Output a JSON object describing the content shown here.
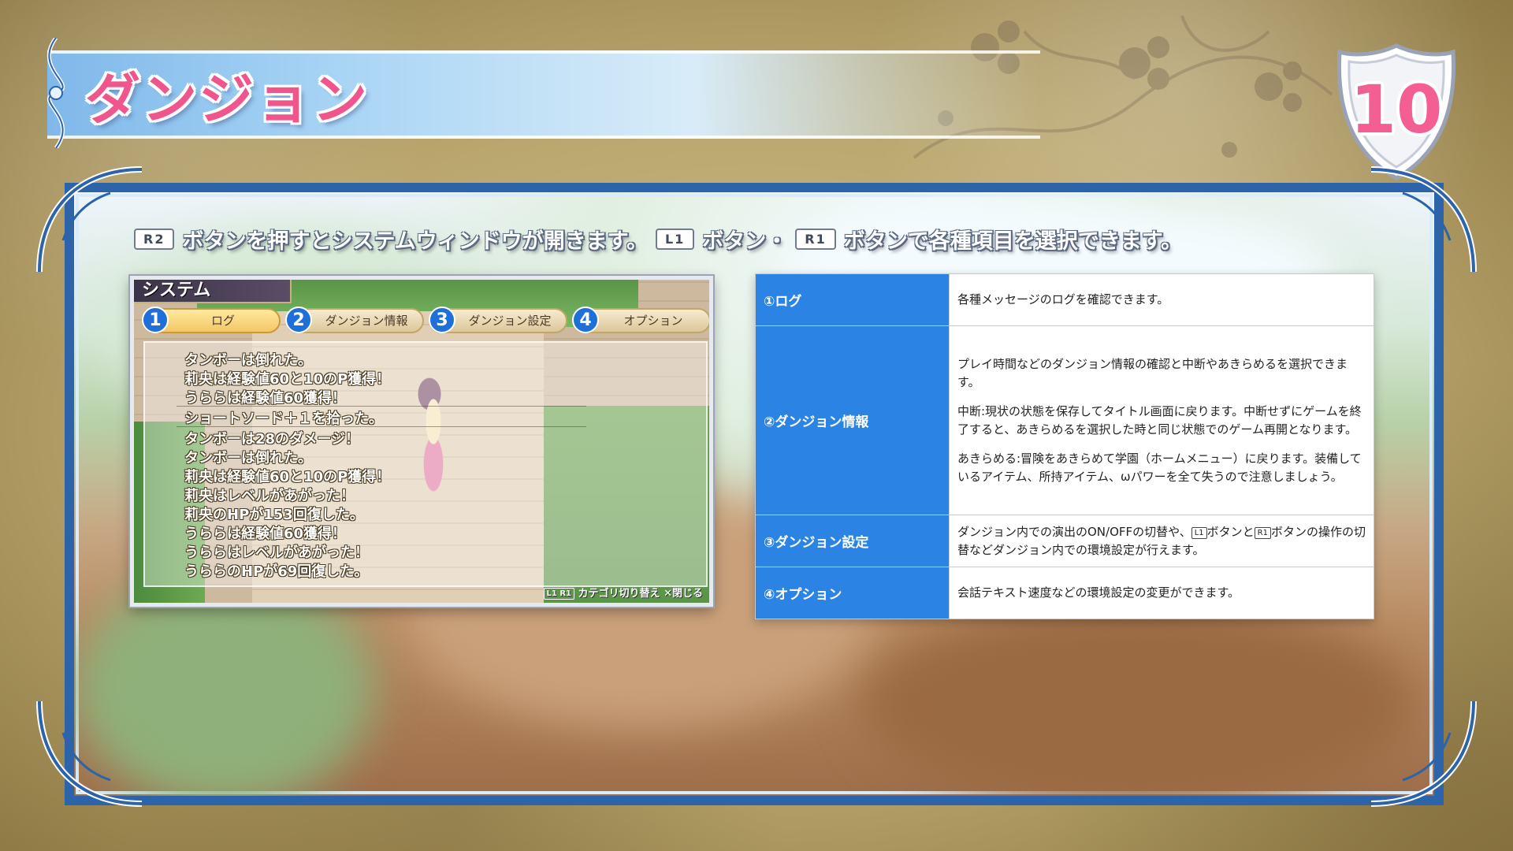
{
  "page": {
    "title": "ダンジョン",
    "page_number": "10"
  },
  "instruction": {
    "btn_r2": "R2",
    "text1": "ボタンを押すとシステムウィンドウが開きます。",
    "btn_l1": "L1",
    "text2": "ボタン・",
    "btn_r1": "R1",
    "text3": "ボタンで各種項目を選択できます。"
  },
  "game_screen": {
    "header": "システム",
    "tabs": [
      {
        "num": "1",
        "label": "ログ"
      },
      {
        "num": "2",
        "label": "ダンジョン情報"
      },
      {
        "num": "3",
        "label": "ダンジョン設定"
      },
      {
        "num": "4",
        "label": "オプション"
      }
    ],
    "log": [
      "タンボーは倒れた。",
      "莉央は経験値60と10のP獲得！",
      "うららは経験値60獲得！",
      "ショートソード＋１を拾った。",
      "タンボーは28のダメージ！",
      "タンボーは倒れた。",
      "莉央は経験値60と10のP獲得！",
      "莉央はレベルがあがった！",
      "莉央のHPが153回復した。",
      "うららは経験値60獲得！",
      "うららはレベルがあがった！",
      "うららのHPが69回復した。"
    ],
    "footer_badges": "L1 R1",
    "footer_category": "カテゴリ切り替え",
    "footer_close": "✕閉じる"
  },
  "table": {
    "rows": [
      {
        "head": "①ログ",
        "body": [
          "各種メッセージのログを確認できます。"
        ]
      },
      {
        "head": "②ダンジョン情報",
        "body": [
          "プレイ時間などのダンジョン情報の確認と中断やあきらめるを選択できます。",
          "中断:現状の状態を保存してタイトル画面に戻ります。中断せずにゲームを終了すると、あきらめるを選択した時と同じ状態でのゲーム再開となります。",
          "あきらめる:冒険をあきらめて学園（ホームメニュー）に戻ります。装備しているアイテム、所持アイテム、ωパワーを全て失うので注意しましょう。"
        ]
      },
      {
        "head": "③ダンジョン設定",
        "body_parts": {
          "a": "ダンジョン内での演出のON/OFFの切替や、",
          "l1": "L1",
          "b": "ボタンと",
          "r1": "R1",
          "c": "ボタンの操作の切替などダンジョン内での環境設定が行えます。"
        }
      },
      {
        "head": "④オプション",
        "body": [
          "会話テキスト速度などの環境設定の変更ができます。"
        ]
      }
    ]
  },
  "colors": {
    "title_pink": "#f0558c",
    "frame_blue": "#2d63a8",
    "table_head_blue": "#2b84e3",
    "tab_number_blue": "#1f6fd8"
  },
  "icons": [
    "shield-emblem-icon",
    "flourish-ornament-icon",
    "close-x-icon"
  ]
}
